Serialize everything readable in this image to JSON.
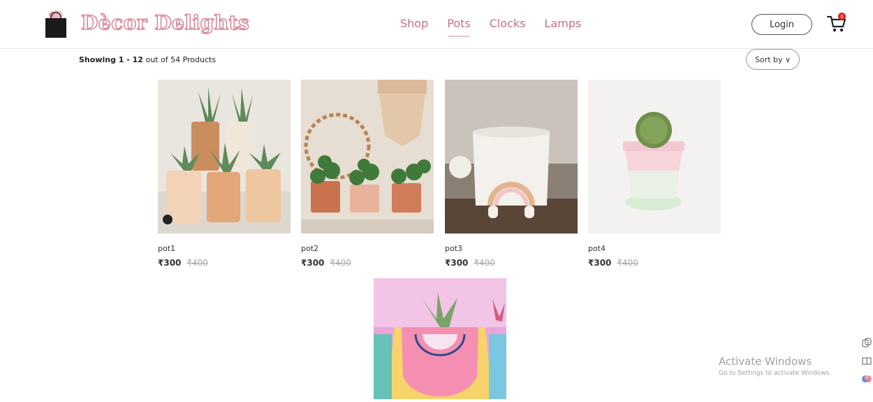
{
  "brand": {
    "name": "Dècor Delights"
  },
  "nav": {
    "items": [
      "Shop",
      "Pots",
      "Clocks",
      "Lamps"
    ],
    "active": "Pots"
  },
  "header": {
    "login_label": "Login",
    "cart_count": "0"
  },
  "toolbar": {
    "showing_bold": "Showing 1 - 12",
    "showing_rest": " out of 54 Products",
    "sort_label": "Sort by ∨"
  },
  "products": [
    {
      "name": "pot1",
      "price": "₹300",
      "old_price": "₹400"
    },
    {
      "name": "pot2",
      "price": "₹300",
      "old_price": "₹400"
    },
    {
      "name": "pot3",
      "price": "₹300",
      "old_price": "₹400"
    },
    {
      "name": "pot4",
      "price": "₹300",
      "old_price": "₹400"
    }
  ],
  "watermark": {
    "title": "Activate Windows",
    "subtitle": "Go to Settings to activate Windows."
  },
  "colors": {
    "accent": "#c0747f",
    "brand_stroke": "#d98a9a",
    "badge": "#e02020"
  },
  "icons": [
    "shopping-bag-logo-icon",
    "cart-icon",
    "chevron-down-icon",
    "user-icon"
  ]
}
